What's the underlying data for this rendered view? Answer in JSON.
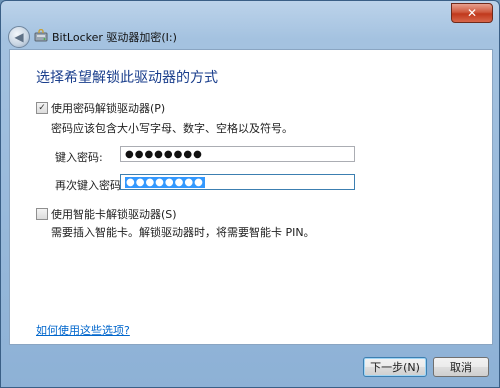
{
  "window": {
    "title": "BitLocker 驱动器加密(I:)",
    "close_glyph": "✕"
  },
  "page": {
    "heading": "选择希望解锁此驱动器的方式",
    "password_option": {
      "checked": true,
      "label": "使用密码解锁驱动器(P)",
      "hint": "密码应该包含大小写字母、数字、空格以及符号。",
      "enter_label": "键入密码:",
      "enter_value": "●●●●●●●●",
      "reenter_label": "再次键入密码:",
      "reenter_value": "●●●●●●●●"
    },
    "smartcard_option": {
      "checked": false,
      "label": "使用智能卡解锁驱动器(S)",
      "hint": "需要插入智能卡。解锁驱动器时，将需要智能卡 PIN。"
    },
    "help_link": "如何使用这些选项?"
  },
  "footer": {
    "next_label": "下一步(N)",
    "cancel_label": "取消"
  },
  "icons": {
    "back": "back-arrow-icon",
    "title": "bitlocker-drive-icon",
    "close": "close-icon"
  }
}
